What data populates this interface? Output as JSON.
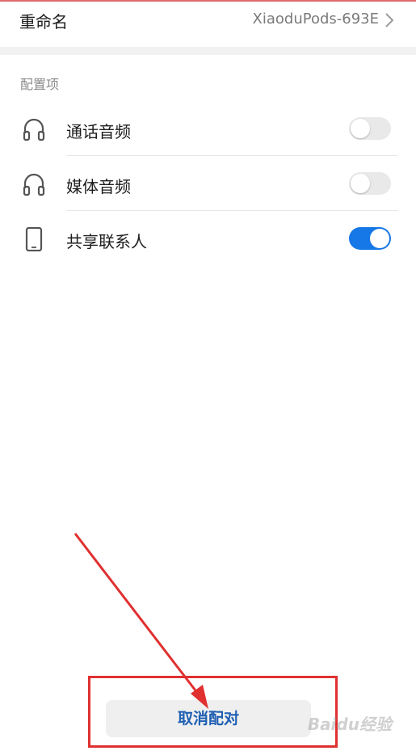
{
  "rename": {
    "label": "重命名",
    "value": "XiaoduPods-693E",
    "chevron_icon": "chevron-right-icon"
  },
  "section": {
    "title": "配置项"
  },
  "items": [
    {
      "icon": "headphones-icon",
      "label": "通话音频",
      "enabled": false
    },
    {
      "icon": "headphones-icon",
      "label": "媒体音频",
      "enabled": false
    },
    {
      "icon": "phone-icon",
      "label": "共享联系人",
      "enabled": true
    }
  ],
  "actions": {
    "unpair_label": "取消配对"
  },
  "watermark": "Baidu经验",
  "colors": {
    "toggle_on": "#1677e6",
    "toggle_off": "#e9e9e9",
    "annotation": "#e03030",
    "unpair_text": "#1f5fb3"
  }
}
